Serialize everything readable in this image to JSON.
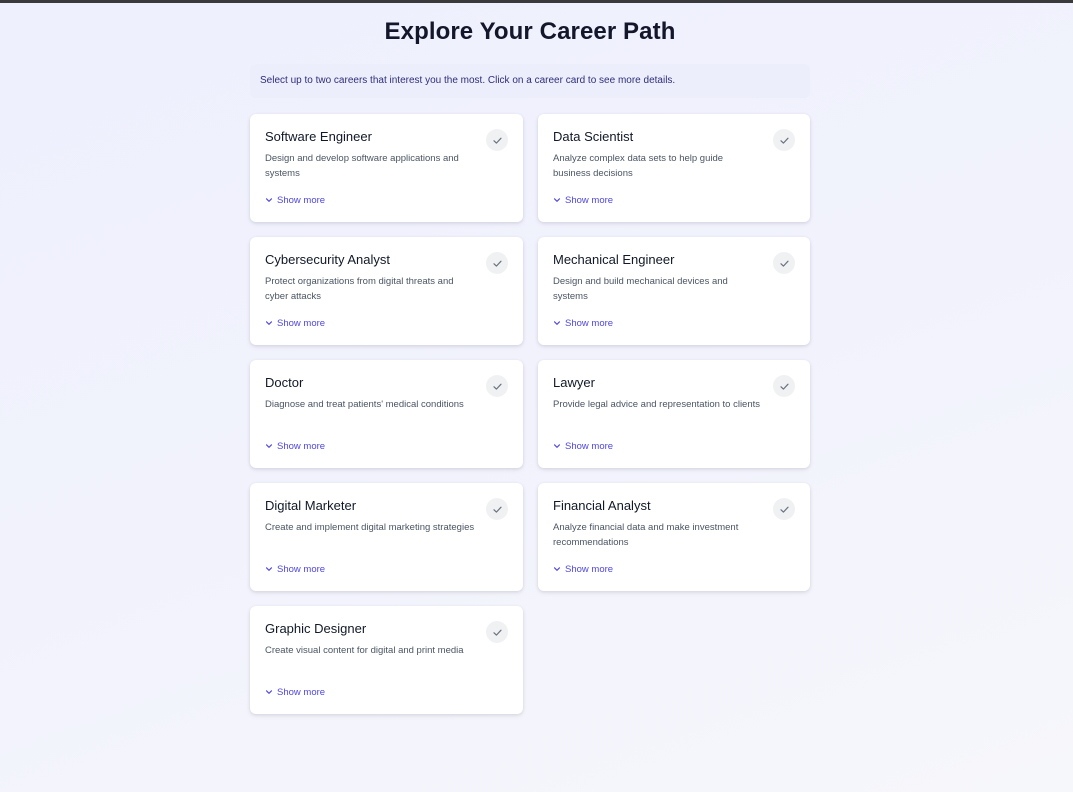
{
  "header": {
    "title": "Explore Your Career Path",
    "instructions": "Select up to two careers that interest you the most. Click on a career card to see more details."
  },
  "careers": [
    {
      "title": "Software Engineer",
      "description": "Design and develop software applications and systems",
      "show_more": "Show more"
    },
    {
      "title": "Data Scientist",
      "description": "Analyze complex data sets to help guide business decisions",
      "show_more": "Show more"
    },
    {
      "title": "Cybersecurity Analyst",
      "description": "Protect organizations from digital threats and cyber attacks",
      "show_more": "Show more"
    },
    {
      "title": "Mechanical Engineer",
      "description": "Design and build mechanical devices and systems",
      "show_more": "Show more"
    },
    {
      "title": "Doctor",
      "description": "Diagnose and treat patients' medical conditions",
      "show_more": "Show more"
    },
    {
      "title": "Lawyer",
      "description": "Provide legal advice and representation to clients",
      "show_more": "Show more"
    },
    {
      "title": "Digital Marketer",
      "description": "Create and implement digital marketing strategies",
      "show_more": "Show more"
    },
    {
      "title": "Financial Analyst",
      "description": "Analyze financial data and make investment recommendations",
      "show_more": "Show more"
    },
    {
      "title": "Graphic Designer",
      "description": "Create visual content for digital and print media",
      "show_more": "Show more"
    }
  ],
  "icons": {
    "select": "check-icon",
    "expand": "chevron-down-icon"
  },
  "colors": {
    "accent": "#4f46e5",
    "instructions_bg": "#eceefc",
    "instructions_text": "#2f2e7a",
    "check_bg": "#f0f1f3",
    "check_icon": "#6b7280"
  }
}
